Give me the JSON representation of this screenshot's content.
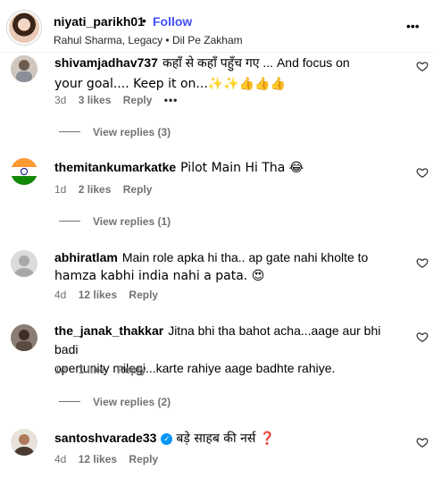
{
  "header": {
    "username": "niyati_parikh01",
    "dot": "•",
    "follow_label": "Follow",
    "subtitle": "Rahul Sharma, Legacy • Dil Pe Zakham",
    "more": "•••"
  },
  "comments": [
    {
      "username": "shivamjadhav737",
      "text_line1": "कहाँ से कहाँ पहुँच गए ... And focus on",
      "text_line2": "your goal.... Keep it on...✨✨👍👍👍",
      "time": "3d",
      "likes": "3 likes",
      "reply": "Reply",
      "more": "•••",
      "view_replies": "View replies (3)"
    },
    {
      "username": "themitankumarkatke",
      "text": "Pilot Main Hi Tha 😂",
      "time": "1d",
      "likes": "2 likes",
      "reply": "Reply",
      "view_replies": "View replies (1)"
    },
    {
      "username": "abhiratlam",
      "text_line1": "Main role apka hi tha.. ap gate nahi kholte to",
      "text_line2": "hamza kabhi india nahi a pata. 😍",
      "time": "4d",
      "likes": "12 likes",
      "reply": "Reply"
    },
    {
      "username": "the_janak_thakkar",
      "text_line1": "Jitna bhi tha bahot acha...aage aur bhi badi",
      "text_line2": "opertunity milegi...karte rahiye aage badhte rahiye.",
      "time": "1d",
      "likes": "1 like",
      "reply": "Reply",
      "view_replies": "View replies (2)"
    },
    {
      "username": "santoshvarade33",
      "verified": "✓",
      "text": "बड़े साहब की नर्स ❓",
      "time": "4d",
      "likes": "12 likes",
      "reply": "Reply"
    }
  ],
  "icons": {
    "heart": "heart-outline-icon"
  }
}
